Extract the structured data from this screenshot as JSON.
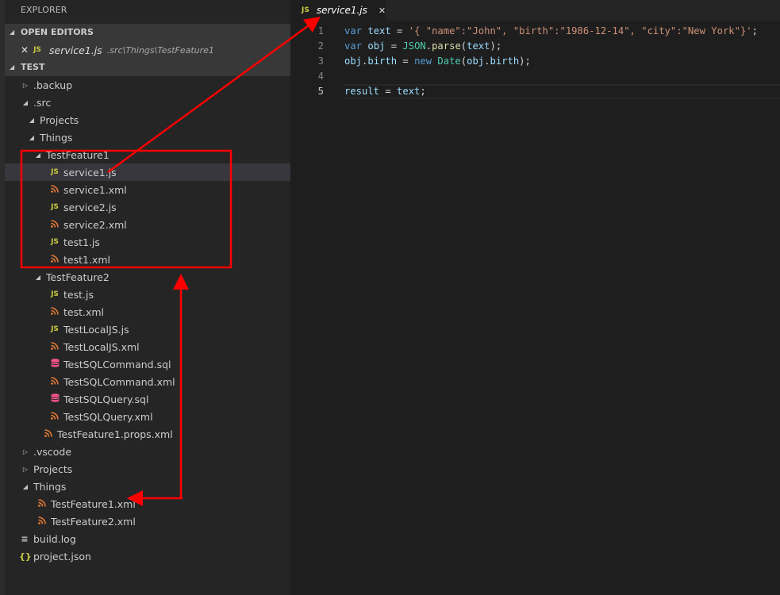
{
  "sidebar": {
    "title": "EXPLORER",
    "open_editors": {
      "header": "OPEN EDITORS",
      "items": [
        {
          "name": "service1.js",
          "path": ".src\\Things\\TestFeature1",
          "icon": "js-file-icon",
          "icon_text": "JS",
          "close_glyph": "✕"
        }
      ]
    },
    "workspace": {
      "header": "TEST",
      "tree": [
        {
          "label": ".backup",
          "depth": 0,
          "type": "folder",
          "expanded": false
        },
        {
          "label": ".src",
          "depth": 0,
          "type": "folder",
          "expanded": true
        },
        {
          "label": "Projects",
          "depth": 1,
          "type": "folder",
          "expanded": true
        },
        {
          "label": "Things",
          "depth": 1,
          "type": "folder",
          "expanded": true
        },
        {
          "label": "TestFeature1",
          "depth": 2,
          "type": "folder",
          "expanded": true
        },
        {
          "label": "service1.js",
          "depth": 3,
          "type": "js",
          "selected": true
        },
        {
          "label": "service1.xml",
          "depth": 3,
          "type": "xml"
        },
        {
          "label": "service2.js",
          "depth": 3,
          "type": "js"
        },
        {
          "label": "service2.xml",
          "depth": 3,
          "type": "xml"
        },
        {
          "label": "test1.js",
          "depth": 3,
          "type": "js"
        },
        {
          "label": "test1.xml",
          "depth": 3,
          "type": "xml"
        },
        {
          "label": "TestFeature2",
          "depth": 2,
          "type": "folder",
          "expanded": true
        },
        {
          "label": "test.js",
          "depth": 3,
          "type": "js"
        },
        {
          "label": "test.xml",
          "depth": 3,
          "type": "xml"
        },
        {
          "label": "TestLocalJS.js",
          "depth": 3,
          "type": "js"
        },
        {
          "label": "TestLocalJS.xml",
          "depth": 3,
          "type": "xml"
        },
        {
          "label": "TestSQLCommand.sql",
          "depth": 3,
          "type": "sql"
        },
        {
          "label": "TestSQLCommand.xml",
          "depth": 3,
          "type": "xml"
        },
        {
          "label": "TestSQLQuery.sql",
          "depth": 3,
          "type": "sql"
        },
        {
          "label": "TestSQLQuery.xml",
          "depth": 3,
          "type": "xml"
        },
        {
          "label": "TestFeature1.props.xml",
          "depth": 2,
          "type": "xml"
        },
        {
          "label": ".vscode",
          "depth": 0,
          "type": "folder",
          "expanded": false
        },
        {
          "label": "Projects",
          "depth": 0,
          "type": "folder",
          "expanded": false
        },
        {
          "label": "Things",
          "depth": 0,
          "type": "folder",
          "expanded": true
        },
        {
          "label": "TestFeature1.xml",
          "depth": 1,
          "type": "xml"
        },
        {
          "label": "TestFeature2.xml",
          "depth": 1,
          "type": "xml"
        },
        {
          "label": "build.log",
          "depth": 0,
          "type": "log"
        },
        {
          "label": "project.json",
          "depth": 0,
          "type": "json"
        }
      ]
    }
  },
  "icons": {
    "js": {
      "name": "js-file-icon",
      "glyph": "JS"
    },
    "xml": {
      "name": "xml-file-icon",
      "glyph": "))"
    },
    "sql": {
      "name": "database-icon",
      "glyph": "⛁"
    },
    "log": {
      "name": "log-file-icon",
      "glyph": "≡"
    },
    "json": {
      "name": "json-file-icon",
      "glyph": "{}"
    },
    "folder_open": {
      "name": "chevron-expanded-icon",
      "glyph": "◢"
    },
    "folder_closed": {
      "name": "chevron-collapsed-icon",
      "glyph": "▷"
    }
  },
  "editor": {
    "tab": {
      "label": "service1.js",
      "icon_text": "JS",
      "close_glyph": "✕"
    },
    "active_line": 5,
    "lines": [
      {
        "number": "1",
        "tokens": [
          [
            "kw",
            "var"
          ],
          [
            "op",
            " "
          ],
          [
            "var",
            "text"
          ],
          [
            "op",
            " = "
          ],
          [
            "str",
            "'{ \"name\":\"John\", \"birth\":\"1986-12-14\", \"city\":\"New York\"}'"
          ],
          [
            "op",
            ";"
          ]
        ]
      },
      {
        "number": "2",
        "tokens": [
          [
            "kw",
            "var"
          ],
          [
            "op",
            " "
          ],
          [
            "var",
            "obj"
          ],
          [
            "op",
            " = "
          ],
          [
            "cls",
            "JSON"
          ],
          [
            "op",
            "."
          ],
          [
            "fn",
            "parse"
          ],
          [
            "op",
            "("
          ],
          [
            "var",
            "text"
          ],
          [
            "op",
            ");"
          ]
        ]
      },
      {
        "number": "3",
        "tokens": [
          [
            "var",
            "obj"
          ],
          [
            "op",
            "."
          ],
          [
            "var",
            "birth"
          ],
          [
            "op",
            " = "
          ],
          [
            "kw",
            "new"
          ],
          [
            "op",
            " "
          ],
          [
            "cls",
            "Date"
          ],
          [
            "op",
            "("
          ],
          [
            "var",
            "obj"
          ],
          [
            "op",
            "."
          ],
          [
            "var",
            "birth"
          ],
          [
            "op",
            ");"
          ]
        ]
      },
      {
        "number": "4",
        "tokens": []
      },
      {
        "number": "5",
        "tokens": [
          [
            "var",
            "result"
          ],
          [
            "op",
            " = "
          ],
          [
            "var",
            "text"
          ],
          [
            "op",
            ";"
          ]
        ]
      }
    ]
  },
  "annotations": {
    "color": "#ff0000"
  }
}
